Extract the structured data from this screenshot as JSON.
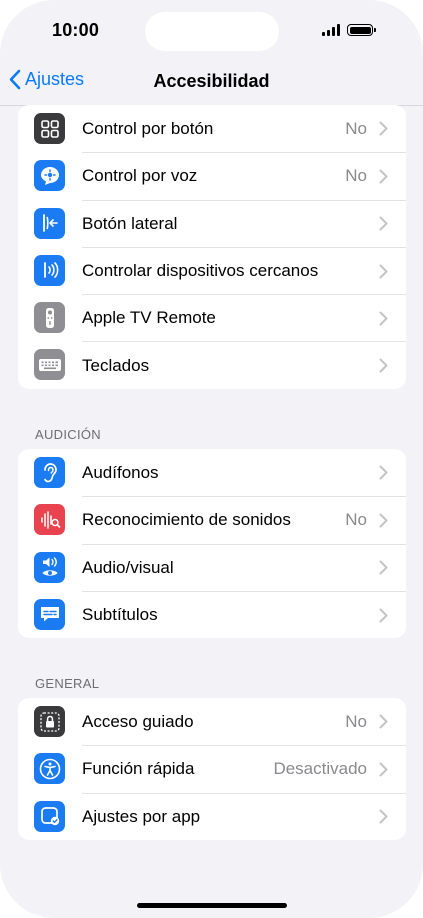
{
  "status": {
    "time": "10:00"
  },
  "nav": {
    "back_label": "Ajustes",
    "title": "Accesibilidad"
  },
  "colors": {
    "accent": "#0a7aff",
    "background": "#f2f2f7"
  },
  "group1": {
    "items": [
      {
        "label": "Control por botón",
        "value": "No",
        "icon": "switch-control-icon",
        "icon_color": "#3a3a3c"
      },
      {
        "label": "Control por voz",
        "value": "No",
        "icon": "voice-control-icon",
        "icon_color": "#1a7bf2"
      },
      {
        "label": "Botón lateral",
        "value": "",
        "icon": "side-button-icon",
        "icon_color": "#1a7bf2"
      },
      {
        "label": "Controlar dispositivos cercanos",
        "value": "",
        "icon": "nearby-devices-icon",
        "icon_color": "#1a7bf2"
      },
      {
        "label": "Apple TV Remote",
        "value": "",
        "icon": "tv-remote-icon",
        "icon_color": "#8e8e93"
      },
      {
        "label": "Teclados",
        "value": "",
        "icon": "keyboard-icon",
        "icon_color": "#8e8e93"
      }
    ]
  },
  "section_audio": {
    "header": "AUDICIÓN"
  },
  "group2": {
    "items": [
      {
        "label": "Audífonos",
        "value": "",
        "icon": "ear-icon",
        "icon_color": "#1a7bf2"
      },
      {
        "label": "Reconocimiento de sonidos",
        "value": "No",
        "icon": "sound-recognition-icon",
        "icon_color": "#e8434f"
      },
      {
        "label": "Audio/visual",
        "value": "",
        "icon": "audio-visual-icon",
        "icon_color": "#1a7bf2"
      },
      {
        "label": "Subtítulos",
        "value": "",
        "icon": "subtitles-icon",
        "icon_color": "#1a7bf2"
      }
    ]
  },
  "section_general": {
    "header": "GENERAL"
  },
  "group3": {
    "items": [
      {
        "label": "Acceso guiado",
        "value": "No",
        "icon": "guided-access-icon",
        "icon_color": "#3a3a3c"
      },
      {
        "label": "Función rápida",
        "value": "Desactivado",
        "icon": "accessibility-shortcut-icon",
        "icon_color": "#1a7bf2"
      },
      {
        "label": "Ajustes por app",
        "value": "",
        "icon": "per-app-settings-icon",
        "icon_color": "#1a7bf2"
      }
    ]
  }
}
